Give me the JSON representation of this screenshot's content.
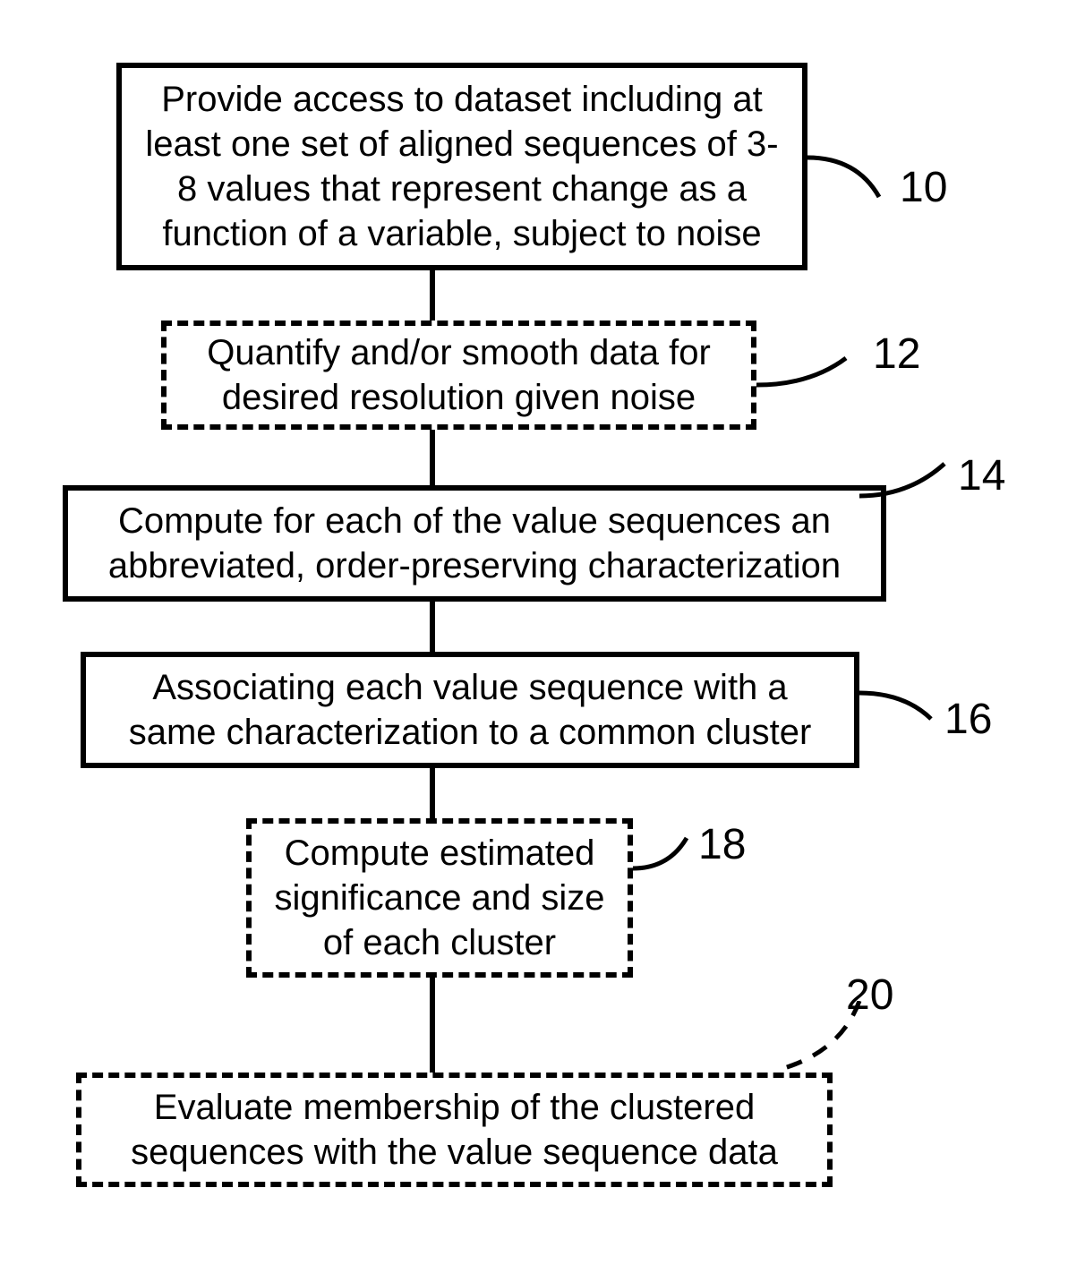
{
  "steps": {
    "s10": {
      "text": "Provide access to dataset including at least one set of aligned sequences of 3-8 values that represent change as a function of a variable, subject to noise",
      "num": "10"
    },
    "s12": {
      "text": "Quantify and/or smooth data for desired resolution given noise",
      "num": "12"
    },
    "s14": {
      "text": "Compute for each of the value sequences an abbreviated, order-preserving characterization",
      "num": "14"
    },
    "s16": {
      "text": "Associating each value sequence with a same characterization to a common cluster",
      "num": "16"
    },
    "s18": {
      "text": "Compute estimated significance and size of each cluster",
      "num": "18"
    },
    "s20": {
      "text": "Evaluate membership of the clustered sequences with the value sequence data",
      "num": "20"
    }
  }
}
